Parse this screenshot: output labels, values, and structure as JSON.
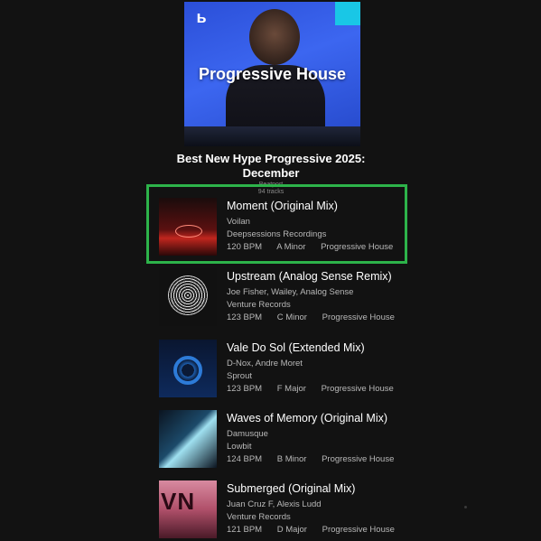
{
  "cover": {
    "title": "Progressive House",
    "logo_icon": "beatport-logo"
  },
  "playlist": {
    "title": "Best New Hype Progressive 2025: December",
    "type": "Beatport",
    "track_count": "94 tracks"
  },
  "tracks": [
    {
      "name": "Moment (Original Mix)",
      "artists": "Voilan",
      "label": "Deepsessions Recordings",
      "bpm": "120 BPM",
      "key": "A Minor",
      "genre": "Progressive House",
      "highlighted": true
    },
    {
      "name": "Upstream (Analog Sense Remix)",
      "artists": "Joe Fisher, Wailey, Analog Sense",
      "label": "Venture Records",
      "bpm": "123 BPM",
      "key": "C Minor",
      "genre": "Progressive House"
    },
    {
      "name": "Vale Do Sol (Extended Mix)",
      "artists": "D-Nox, Andre Moret",
      "label": "Sprout",
      "bpm": "123 BPM",
      "key": "F Major",
      "genre": "Progressive House"
    },
    {
      "name": "Waves of Memory (Original Mix)",
      "artists": "Damusque",
      "label": "Lowbit",
      "bpm": "124 BPM",
      "key": "B Minor",
      "genre": "Progressive House"
    },
    {
      "name": "Submerged (Original Mix)",
      "artists": "Juan Cruz F, Alexis Ludd",
      "label": "Venture Records",
      "bpm": "121 BPM",
      "key": "D Major",
      "genre": "Progressive House"
    }
  ],
  "colors": {
    "background": "#121212",
    "highlight_border": "#2db34a",
    "cover_blue": "#3c66f0",
    "accent_cyan": "#19c7e6"
  }
}
